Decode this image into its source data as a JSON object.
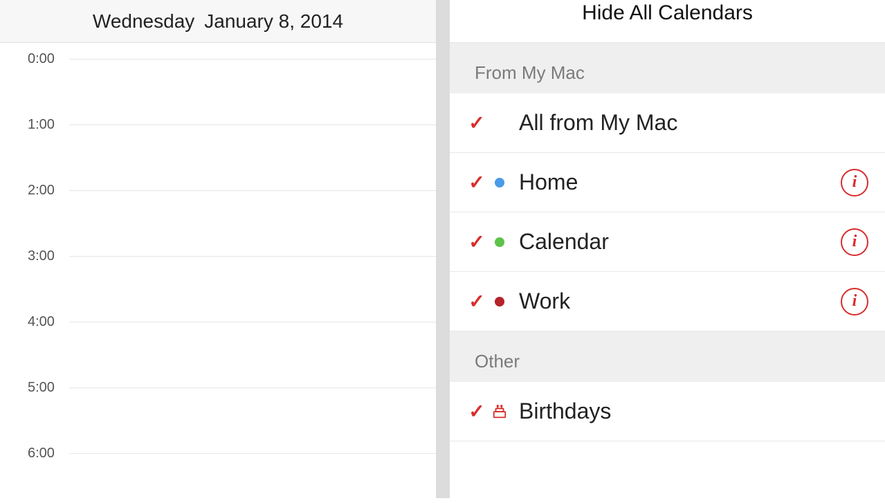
{
  "date": {
    "weekday": "Wednesday",
    "full": "January 8, 2014"
  },
  "hours": [
    "0:00",
    "1:00",
    "2:00",
    "3:00",
    "4:00",
    "5:00",
    "6:00"
  ],
  "hideAll": "Hide All Calendars",
  "sections": {
    "mac": {
      "title": "From My Mac",
      "all": "All from My Mac",
      "items": [
        {
          "name": "Home",
          "color": "blue"
        },
        {
          "name": "Calendar",
          "color": "green"
        },
        {
          "name": "Work",
          "color": "red"
        }
      ]
    },
    "other": {
      "title": "Other",
      "items": [
        {
          "name": "Birthdays"
        }
      ]
    }
  }
}
